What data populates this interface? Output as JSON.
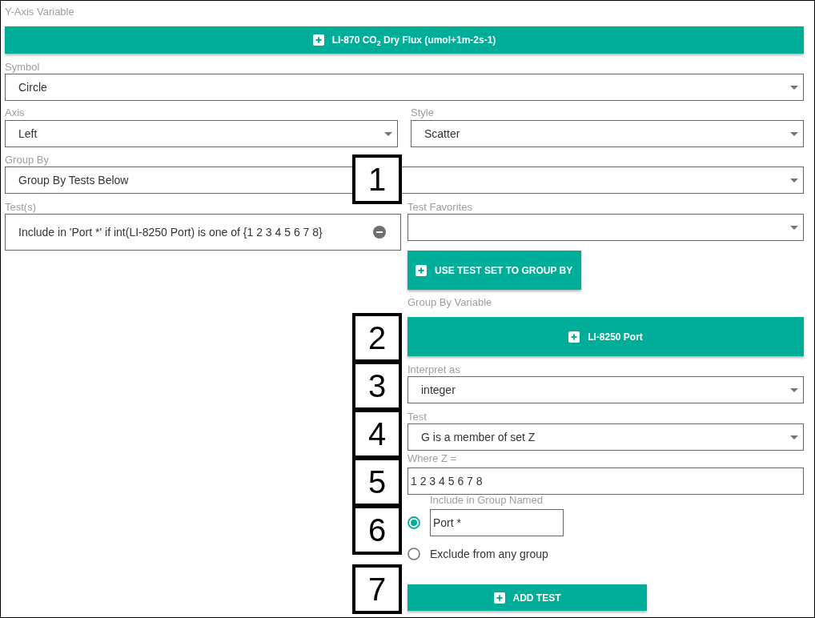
{
  "y_axis_variable": {
    "label": "Y-Axis Variable",
    "button": "LI-870 CO$_{2}$ Dry Flux (umol+1m-2s-1)"
  },
  "symbol": {
    "label": "Symbol",
    "value": "Circle"
  },
  "axis": {
    "label": "Axis",
    "value": "Left"
  },
  "style": {
    "label": "Style",
    "value": "Scatter"
  },
  "group_by": {
    "label": "Group By",
    "value": "Group By Tests Below"
  },
  "tests": {
    "label": "Test(s)",
    "items": [
      "Include in 'Port *' if int(LI-8250 Port) is one of {1 2 3 4 5 6 7 8}"
    ]
  },
  "test_favorites": {
    "label": "Test Favorites"
  },
  "use_test_set_button": "USE TEST SET TO GROUP BY",
  "group_by_variable": {
    "label": "Group By Variable",
    "button": "LI-8250 Port"
  },
  "interpret_as": {
    "label": "Interpret as",
    "value": "integer"
  },
  "test": {
    "label": "Test",
    "value": "G is a member of set Z"
  },
  "where_z": {
    "label": "Where Z =",
    "value": "1 2 3 4 5 6 7 8"
  },
  "group_options": [
    {
      "kind": "named",
      "label": "Include in Group Named",
      "value": "Port *",
      "selected": true
    },
    {
      "kind": "plain",
      "label": "Exclude from any group",
      "selected": false
    }
  ],
  "add_test_button": "ADD TEST",
  "callouts": [
    "1",
    "2",
    "3",
    "4",
    "5",
    "6",
    "7"
  ]
}
